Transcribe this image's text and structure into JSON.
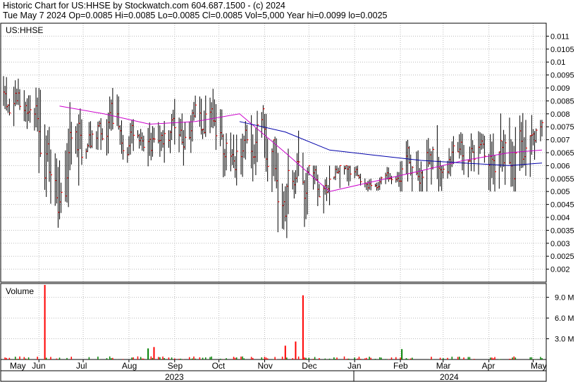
{
  "header": {
    "line1": "Historic Chart for US:HHSE by Stockwatch.com 604.687.1500 - (c) 2024",
    "line2": "Tue May  7 2024  Op=0.0085  Hi=0.0085  Lo=0.0085  Cl=0.0085  Vol=5,000  Year hi=0.0099  lo=0.0025"
  },
  "chart_data": {
    "type": "ohlc",
    "price_panel_label": "US:HHSE",
    "volume_panel_label": "Volume",
    "price_axis": {
      "ylim": [
        0.0015,
        0.0115
      ],
      "ticks": [
        "0.011",
        "0.0105",
        "0.01",
        "0.0095",
        "0.009",
        "0.0085",
        "0.008",
        "0.0075",
        "0.007",
        "0.0065",
        "0.006",
        "0.0055",
        "0.005",
        "0.0045",
        "0.004",
        "0.0035",
        "0.003",
        "0.0025",
        "0.002"
      ]
    },
    "volume_axis": {
      "ylim": [
        0,
        11000000
      ],
      "ticks": [
        "9.0 M",
        "6.0 M",
        "3.0 M"
      ]
    },
    "x_axis": {
      "month_labels": [
        "May",
        "Jun",
        "Jul",
        "Aug",
        "Sep",
        "Oct",
        "Nov",
        "Dec",
        "Jan",
        "Feb",
        "Mar",
        "Apr",
        "May"
      ],
      "year_labels": [
        "2023",
        "2024"
      ]
    },
    "date_range": [
      "2023-05-08",
      "2024-05-07"
    ],
    "colors": {
      "up": "#008000",
      "down": "#ff0000",
      "ma_short": "#cc00cc",
      "ma_long": "#0000aa"
    },
    "price_series_monthly": [
      {
        "month": "2023-05",
        "open": 0.009,
        "high": 0.0099,
        "low": 0.007,
        "close": 0.0078
      },
      {
        "month": "2023-06",
        "open": 0.0078,
        "high": 0.009,
        "low": 0.0025,
        "close": 0.0075
      },
      {
        "month": "2023-07",
        "open": 0.0075,
        "high": 0.009,
        "low": 0.006,
        "close": 0.0073
      },
      {
        "month": "2023-08",
        "open": 0.0073,
        "high": 0.0085,
        "low": 0.0055,
        "close": 0.0076
      },
      {
        "month": "2023-09",
        "open": 0.0076,
        "high": 0.0095,
        "low": 0.006,
        "close": 0.0077
      },
      {
        "month": "2023-10",
        "open": 0.0077,
        "high": 0.0089,
        "low": 0.005,
        "close": 0.0072
      },
      {
        "month": "2023-11",
        "open": 0.0072,
        "high": 0.008,
        "low": 0.0032,
        "close": 0.0052
      },
      {
        "month": "2023-12",
        "open": 0.0052,
        "high": 0.006,
        "low": 0.0034,
        "close": 0.0055
      },
      {
        "month": "2024-01",
        "open": 0.0055,
        "high": 0.006,
        "low": 0.005,
        "close": 0.0054
      },
      {
        "month": "2024-02",
        "open": 0.0054,
        "high": 0.0093,
        "low": 0.005,
        "close": 0.0062
      },
      {
        "month": "2024-03",
        "open": 0.0062,
        "high": 0.008,
        "low": 0.0055,
        "close": 0.0063
      },
      {
        "month": "2024-04",
        "open": 0.0063,
        "high": 0.0095,
        "low": 0.005,
        "close": 0.0065
      },
      {
        "month": "2024-05",
        "open": 0.0065,
        "high": 0.0085,
        "low": 0.005,
        "close": 0.0085
      }
    ],
    "ma_short_monthly": [
      0.0088,
      0.0083,
      0.008,
      0.0076,
      0.0077,
      0.008,
      0.0065,
      0.005,
      0.0054,
      0.0058,
      0.0062,
      0.0065,
      0.0066
    ],
    "ma_long_monthly": [
      0.0082,
      0.008,
      0.0079,
      0.0077,
      0.0078,
      0.0077,
      0.0073,
      0.0066,
      0.0064,
      0.0062,
      0.0061,
      0.006,
      0.0061
    ],
    "volume_spikes": [
      {
        "date": "2023-06-05",
        "value": 10800000,
        "color": "#ff0000"
      },
      {
        "date": "2023-11-27",
        "value": 9300000,
        "color": "#ff0000"
      },
      {
        "date": "2023-11-22",
        "value": 2600000,
        "color": "#ff0000"
      },
      {
        "date": "2023-11-15",
        "value": 2000000,
        "color": "#ff0000"
      },
      {
        "date": "2024-02-02",
        "value": 1500000,
        "color": "#008000"
      },
      {
        "date": "2023-08-18",
        "value": 1800000,
        "color": "#ff0000"
      },
      {
        "date": "2023-08-14",
        "value": 1600000,
        "color": "#008000"
      }
    ]
  }
}
